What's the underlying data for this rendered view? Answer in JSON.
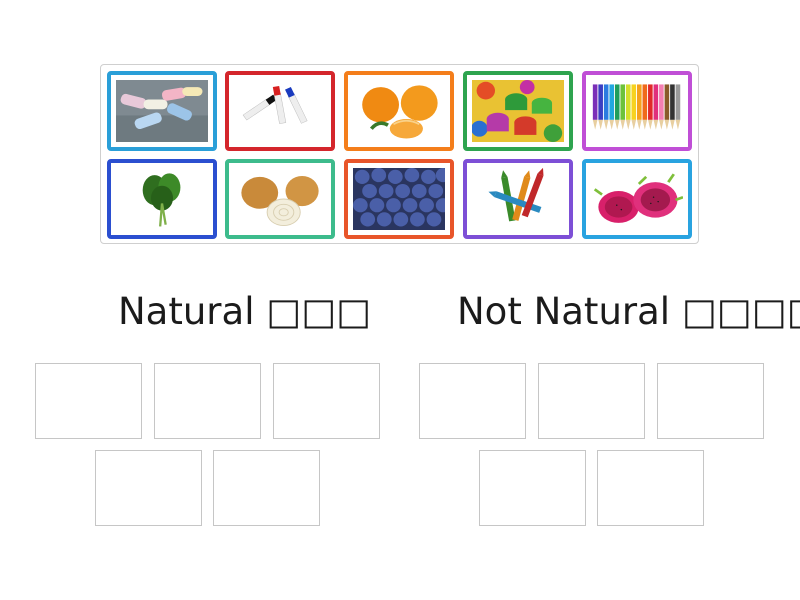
{
  "activity": {
    "cards": [
      {
        "name": "chalk-card",
        "icon": "chalk-image",
        "border": "#2a9fd8"
      },
      {
        "name": "markers-card",
        "icon": "whiteboard-markers-image",
        "border": "#d4262c"
      },
      {
        "name": "tangerines-card",
        "icon": "tangerines-image",
        "border": "#f47e1b"
      },
      {
        "name": "paint-cans-card",
        "icon": "paint-cans-image",
        "border": "#2ea44f"
      },
      {
        "name": "colored-pencils-card",
        "icon": "colored-pencils-image",
        "border": "#c04fd6"
      },
      {
        "name": "spinach-card",
        "icon": "spinach-image",
        "border": "#2b4fd0"
      },
      {
        "name": "onions-card",
        "icon": "onions-image",
        "border": "#3dbb8c"
      },
      {
        "name": "blueberries-card",
        "icon": "blueberries-image",
        "border": "#e8552a"
      },
      {
        "name": "crayons-card",
        "icon": "crayons-image",
        "border": "#7d4fd6"
      },
      {
        "name": "dragon-fruit-card",
        "icon": "dragon-fruit-image",
        "border": "#29a3e0"
      }
    ],
    "groups": [
      {
        "title": "Natural □□□",
        "slots": 5
      },
      {
        "title": "Not Natural □□□□",
        "slots": 5
      }
    ]
  }
}
